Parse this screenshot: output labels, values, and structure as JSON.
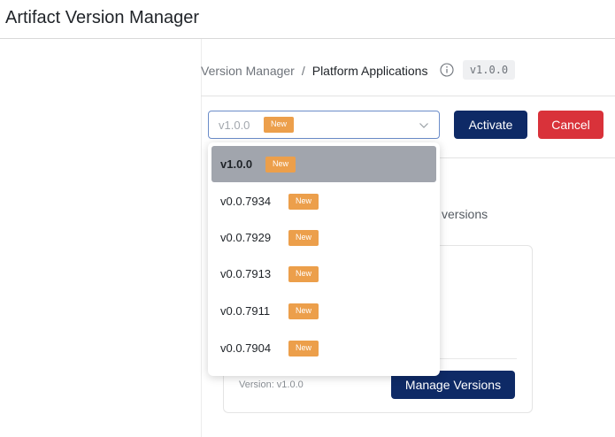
{
  "app": {
    "title": "Artifact Version Manager"
  },
  "breadcrumb": {
    "root": "Version Manager",
    "separator": "/",
    "current": "Platform Applications",
    "version_chip": "v1.0.0"
  },
  "toolbar": {
    "select": {
      "value": "v1.0.0",
      "badge": "New"
    },
    "activate_label": "Activate",
    "cancel_label": "Cancel"
  },
  "background": {
    "versions_text": "versions"
  },
  "card": {
    "version_text": "Version: v1.0.0",
    "manage_label": "Manage Versions"
  },
  "dropdown": {
    "options": [
      {
        "label": "v1.0.0",
        "badge": "New",
        "selected": true
      },
      {
        "label": "v0.0.7934",
        "badge": "New",
        "selected": false
      },
      {
        "label": "v0.0.7929",
        "badge": "New",
        "selected": false
      },
      {
        "label": "v0.0.7913",
        "badge": "New",
        "selected": false
      },
      {
        "label": "v0.0.7911",
        "badge": "New",
        "selected": false
      },
      {
        "label": "v0.0.7904",
        "badge": "New",
        "selected": false
      }
    ]
  },
  "colors": {
    "primary": "#0e2a66",
    "danger": "#d9323a",
    "badge": "#ec9f4b",
    "selected_row": "#a1a5ad"
  },
  "icons": {
    "info": "info-icon",
    "chevron": "chevron-down-icon"
  }
}
